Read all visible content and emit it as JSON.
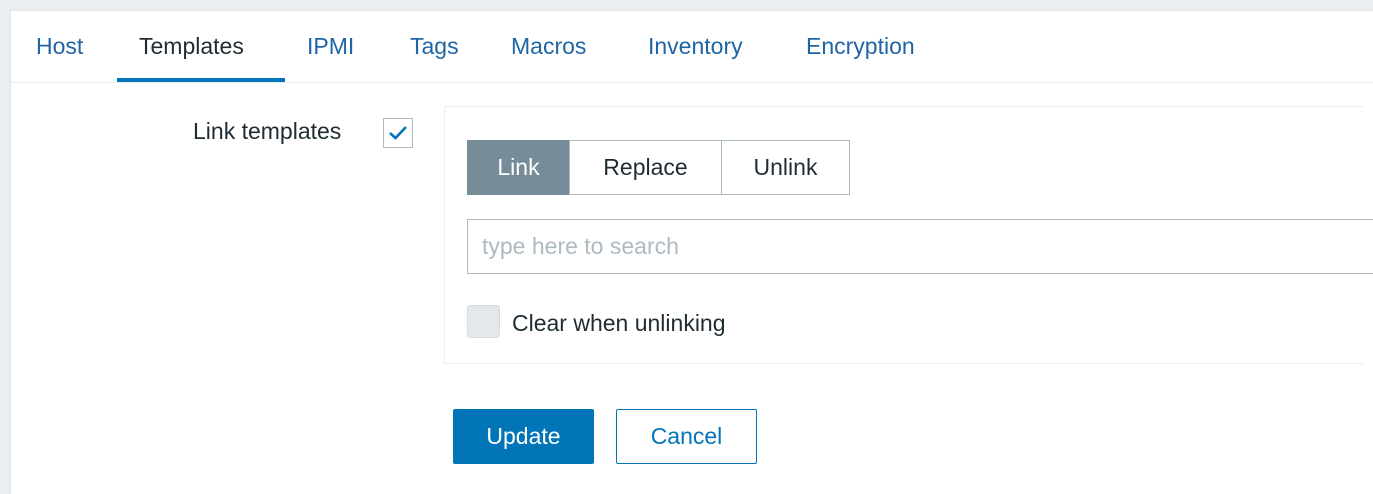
{
  "tabs": [
    {
      "label": "Host",
      "active": false
    },
    {
      "label": "Templates",
      "active": true
    },
    {
      "label": "IPMI",
      "active": false
    },
    {
      "label": "Tags",
      "active": false
    },
    {
      "label": "Macros",
      "active": false
    },
    {
      "label": "Inventory",
      "active": false
    },
    {
      "label": "Encryption",
      "active": false
    }
  ],
  "form": {
    "link_templates_label": "Link templates",
    "link_templates_checked": true,
    "mode_options": [
      "Link",
      "Replace",
      "Unlink"
    ],
    "mode_selected": "Link",
    "search_placeholder": "type here to search",
    "clear_label": "Clear when unlinking",
    "clear_checked": false
  },
  "actions": {
    "update_label": "Update",
    "cancel_label": "Cancel"
  },
  "colors": {
    "accent": "#0275b8",
    "link": "#1f65a6",
    "selected_segment": "#768d99",
    "text": "#1f2c33"
  },
  "icons": {
    "checkmark": "check-icon"
  }
}
